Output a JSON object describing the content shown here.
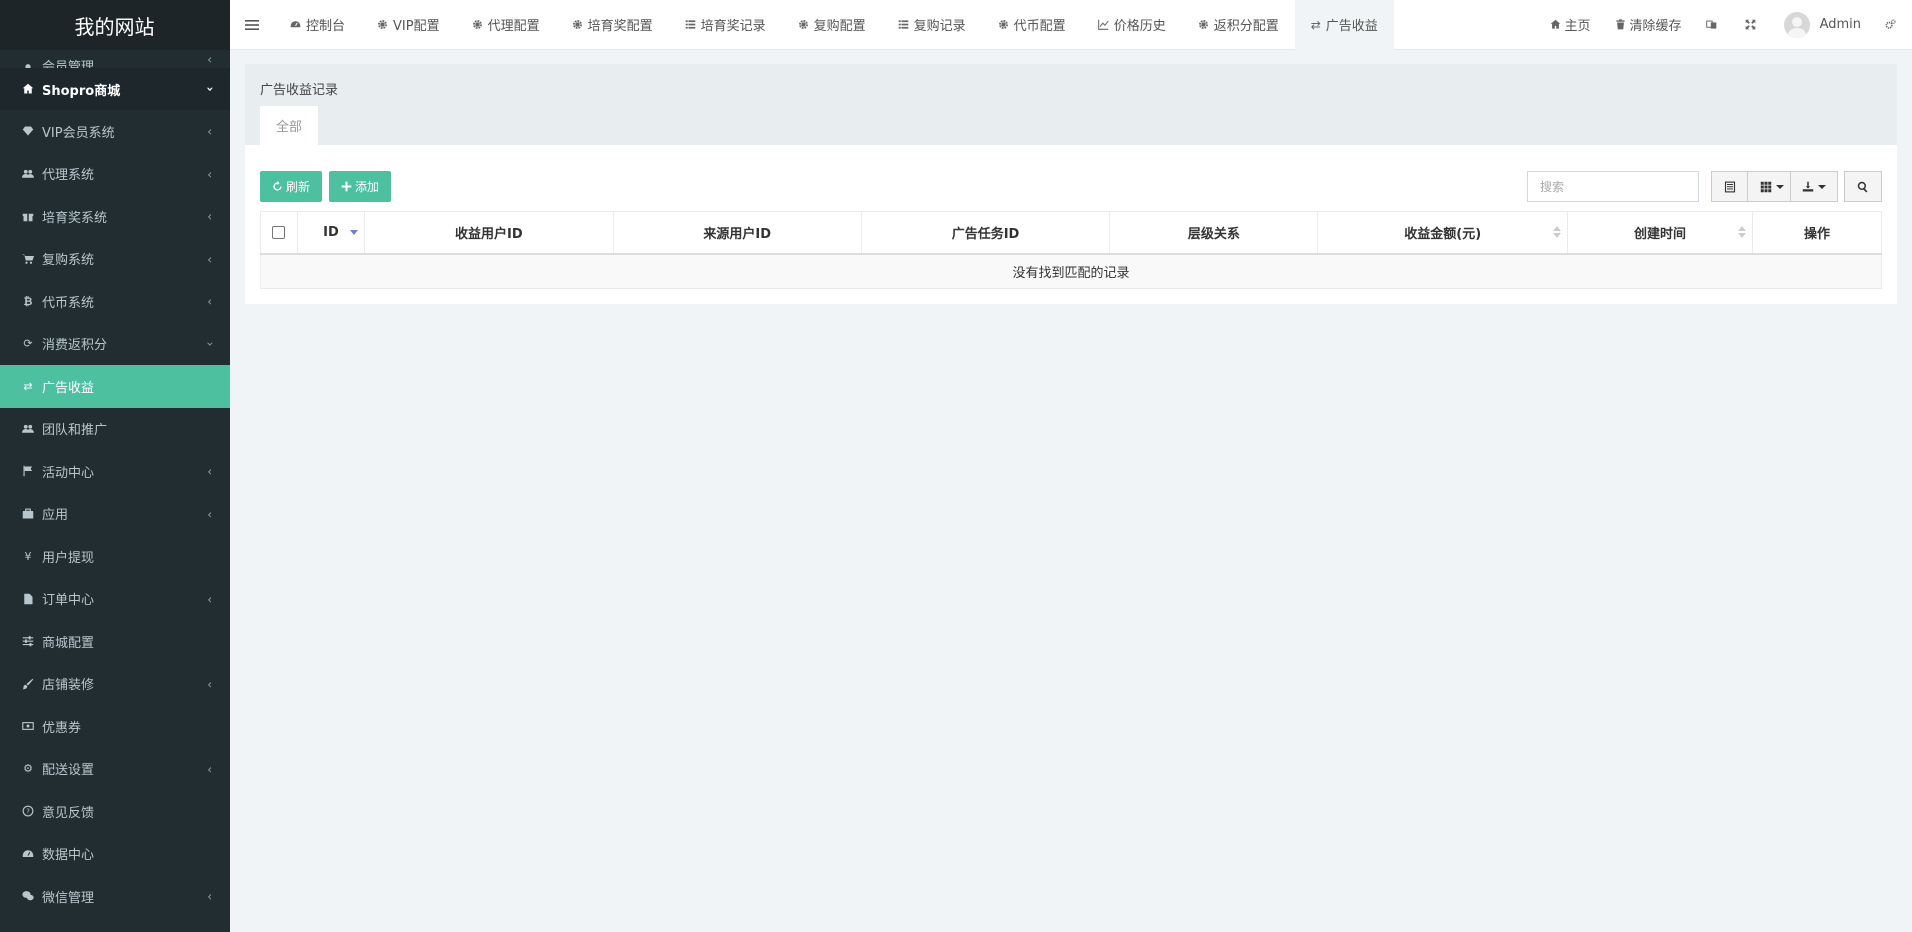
{
  "site": {
    "title": "我的网站"
  },
  "sidebar": {
    "items": [
      {
        "label": "会员管理",
        "icon": "user-icon"
      },
      {
        "label": "Shopro商城",
        "icon": "home-icon"
      },
      {
        "label": "VIP会员系统",
        "icon": "diamond-icon"
      },
      {
        "label": "代理系统",
        "icon": "users-icon"
      },
      {
        "label": "培育奖系统",
        "icon": "gift-icon"
      },
      {
        "label": "复购系统",
        "icon": "cart-icon"
      },
      {
        "label": "代币系统",
        "icon": "bitcoin-icon"
      },
      {
        "label": "消费返积分",
        "icon": "refresh-icon"
      },
      {
        "label": "广告收益",
        "icon": "exchange-icon"
      },
      {
        "label": "团队和推广",
        "icon": "users-icon"
      },
      {
        "label": "活动中心",
        "icon": "flag-icon"
      },
      {
        "label": "应用",
        "icon": "briefcase-icon"
      },
      {
        "label": "用户提现",
        "icon": "yen-icon"
      },
      {
        "label": "订单中心",
        "icon": "file-icon"
      },
      {
        "label": "商城配置",
        "icon": "sliders-icon"
      },
      {
        "label": "店铺装修",
        "icon": "brush-icon"
      },
      {
        "label": "优惠券",
        "icon": "money-icon"
      },
      {
        "label": "配送设置",
        "icon": "cogs-icon"
      },
      {
        "label": "意见反馈",
        "icon": "question-icon"
      },
      {
        "label": "数据中心",
        "icon": "dashboard-icon"
      },
      {
        "label": "微信管理",
        "icon": "wechat-icon"
      }
    ]
  },
  "topnav": {
    "tabs": [
      {
        "label": "控制台",
        "icon": "dashboard-icon"
      },
      {
        "label": "VIP配置",
        "icon": "gear-icon"
      },
      {
        "label": "代理配置",
        "icon": "gear-icon"
      },
      {
        "label": "培育奖配置",
        "icon": "gear-icon"
      },
      {
        "label": "培育奖记录",
        "icon": "list-icon"
      },
      {
        "label": "复购配置",
        "icon": "gear-icon"
      },
      {
        "label": "复购记录",
        "icon": "list-icon"
      },
      {
        "label": "代币配置",
        "icon": "gear-icon"
      },
      {
        "label": "价格历史",
        "icon": "line-chart-icon"
      },
      {
        "label": "返积分配置",
        "icon": "gear-icon"
      },
      {
        "label": "广告收益",
        "icon": "exchange-icon"
      }
    ],
    "home": "主页",
    "clear_cache": "清除缓存",
    "user": "Admin"
  },
  "panel": {
    "title": "广告收益记录",
    "tab_all": "全部",
    "refresh": "刷新",
    "add": "添加",
    "search_placeholder": "搜索"
  },
  "table": {
    "columns": [
      "ID",
      "收益用户ID",
      "来源用户ID",
      "广告任务ID",
      "层级关系",
      "收益金额(元)",
      "创建时间",
      "操作"
    ],
    "empty": "没有找到匹配的记录"
  },
  "colors": {
    "accent": "#4cc09f",
    "sidebar_bg": "#222d32",
    "sort_active": "#6f7ed1"
  }
}
